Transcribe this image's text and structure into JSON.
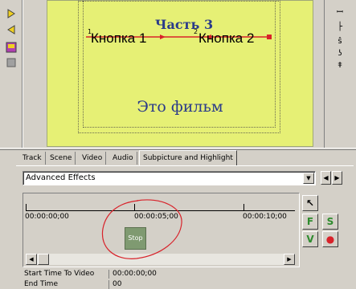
{
  "left_toolbar": {
    "icons": [
      "triangle-pointer-icon",
      "triangle-pointer-icon",
      "image-edit-icon",
      "small-tool-icon"
    ]
  },
  "right_toolbar": {
    "glyphs": [
      "ꟷ",
      "├",
      "ŝ",
      "ʖ",
      "ǂ"
    ]
  },
  "canvas": {
    "title": "Часть 3",
    "button_1": "Кнопка 1",
    "button_2": "Кнопка 2",
    "marker_1": "1",
    "marker_2": "2",
    "film_text": "Это фильм",
    "background_color": "#e6f075"
  },
  "tabs": [
    {
      "label": "Track",
      "active": false
    },
    {
      "label": "Scene",
      "active": false
    },
    {
      "label": "Video",
      "active": false
    },
    {
      "label": "Audio",
      "active": false
    },
    {
      "label": "Subpicture and Highlight",
      "active": true
    }
  ],
  "effects_combo": {
    "value": "Advanced Effects"
  },
  "nav_buttons": {
    "prev": "◀",
    "next": "▶"
  },
  "timeline": {
    "time_labels": [
      "00:00:00;00",
      "00:00:05;00",
      "00:00:10;00"
    ],
    "block_label": "Stop",
    "block_color": "#7f9a71"
  },
  "tools": {
    "select": "↖",
    "f": "F",
    "s": "S",
    "v": "V",
    "record": "●"
  },
  "properties": [
    {
      "name": "Start Time To Video",
      "value": "00:00:00;00"
    },
    {
      "name": "End Time",
      "value": "00"
    }
  ],
  "colors": {
    "annotation_red": "#d8222a",
    "accent_green": "#2e8b2e"
  }
}
